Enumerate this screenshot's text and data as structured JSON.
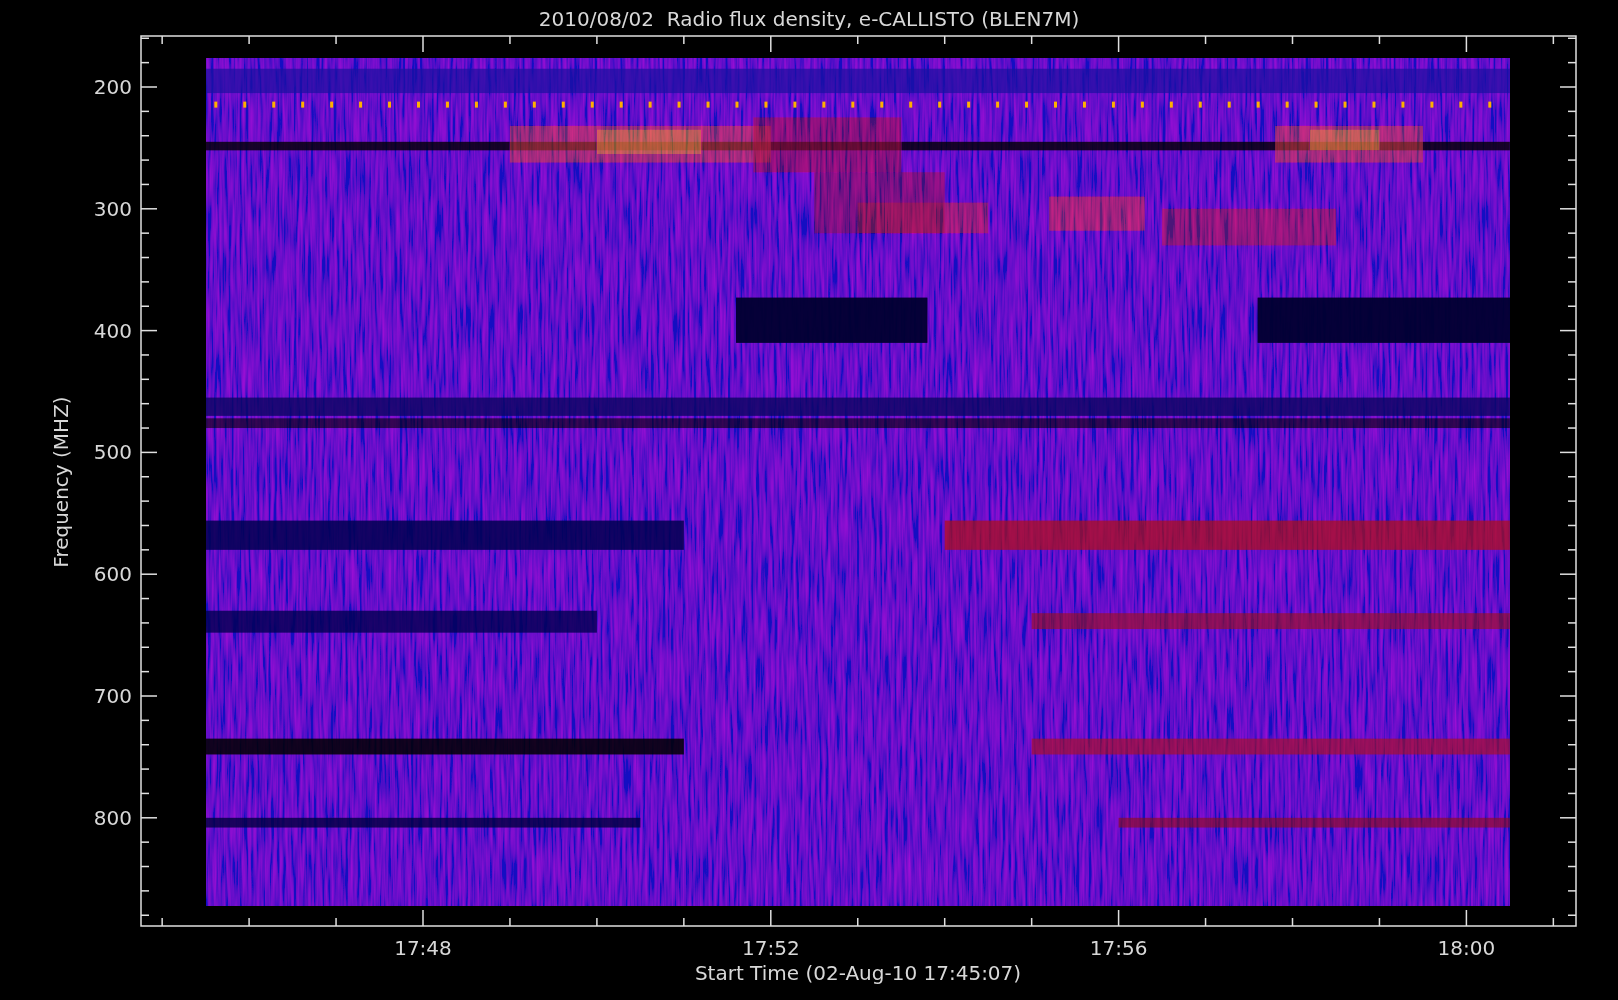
{
  "title": "2010/08/02  Radio flux density, e-CALLISTO (BLEN7M)",
  "ylabel": "Frequency (MHZ)",
  "xlabel": "Start Time (02-Aug-10 17:45:07)",
  "yticks": [
    "200",
    "300",
    "400",
    "500",
    "600",
    "700",
    "800"
  ],
  "xticks": [
    "17:48",
    "17:52",
    "17:56",
    "18:00"
  ]
}
